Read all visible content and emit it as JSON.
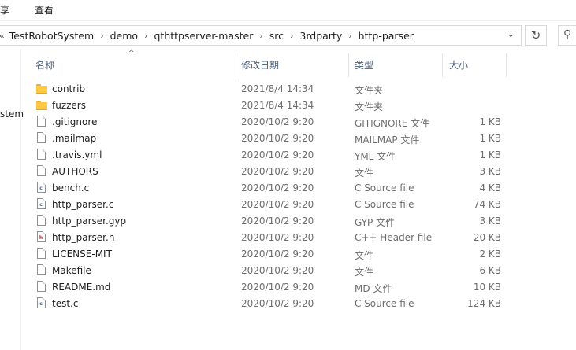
{
  "ribbon": {
    "tab_share": "共享",
    "tab_view": "查看"
  },
  "address": {
    "crumbs": [
      "TestRobotSystem",
      "demo",
      "qthttpserver-master",
      "src",
      "3rdparty",
      "http-parser"
    ]
  },
  "nav": {
    "partial_item": "stem"
  },
  "columns": {
    "name": "名称",
    "date": "修改日期",
    "type": "类型",
    "size": "大小"
  },
  "files": [
    {
      "name": "contrib",
      "date": "2021/8/4 14:34",
      "type": "文件夹",
      "size": "",
      "icon": "folder-icon"
    },
    {
      "name": "fuzzers",
      "date": "2021/8/4 14:34",
      "type": "文件夹",
      "size": "",
      "icon": "folder-icon"
    },
    {
      "name": ".gitignore",
      "date": "2020/10/2 9:20",
      "type": "GITIGNORE 文件",
      "size": "1 KB",
      "icon": "file-icon"
    },
    {
      "name": ".mailmap",
      "date": "2020/10/2 9:20",
      "type": "MAILMAP 文件",
      "size": "1 KB",
      "icon": "file-icon"
    },
    {
      "name": ".travis.yml",
      "date": "2020/10/2 9:20",
      "type": "YML 文件",
      "size": "1 KB",
      "icon": "file-icon"
    },
    {
      "name": "AUTHORS",
      "date": "2020/10/2 9:20",
      "type": "文件",
      "size": "3 KB",
      "icon": "file-icon"
    },
    {
      "name": "bench.c",
      "date": "2020/10/2 9:20",
      "type": "C Source file",
      "size": "4 KB",
      "icon": "c-source-icon"
    },
    {
      "name": "http_parser.c",
      "date": "2020/10/2 9:20",
      "type": "C Source file",
      "size": "74 KB",
      "icon": "c-source-icon"
    },
    {
      "name": "http_parser.gyp",
      "date": "2020/10/2 9:20",
      "type": "GYP 文件",
      "size": "3 KB",
      "icon": "file-icon"
    },
    {
      "name": "http_parser.h",
      "date": "2020/10/2 9:20",
      "type": "C++ Header file",
      "size": "20 KB",
      "icon": "c-header-icon"
    },
    {
      "name": "LICENSE-MIT",
      "date": "2020/10/2 9:20",
      "type": "文件",
      "size": "2 KB",
      "icon": "file-icon"
    },
    {
      "name": "Makefile",
      "date": "2020/10/2 9:20",
      "type": "文件",
      "size": "6 KB",
      "icon": "file-icon"
    },
    {
      "name": "README.md",
      "date": "2020/10/2 9:20",
      "type": "MD 文件",
      "size": "10 KB",
      "icon": "file-icon"
    },
    {
      "name": "test.c",
      "date": "2020/10/2 9:20",
      "type": "C Source file",
      "size": "124 KB",
      "icon": "c-source-icon"
    }
  ]
}
